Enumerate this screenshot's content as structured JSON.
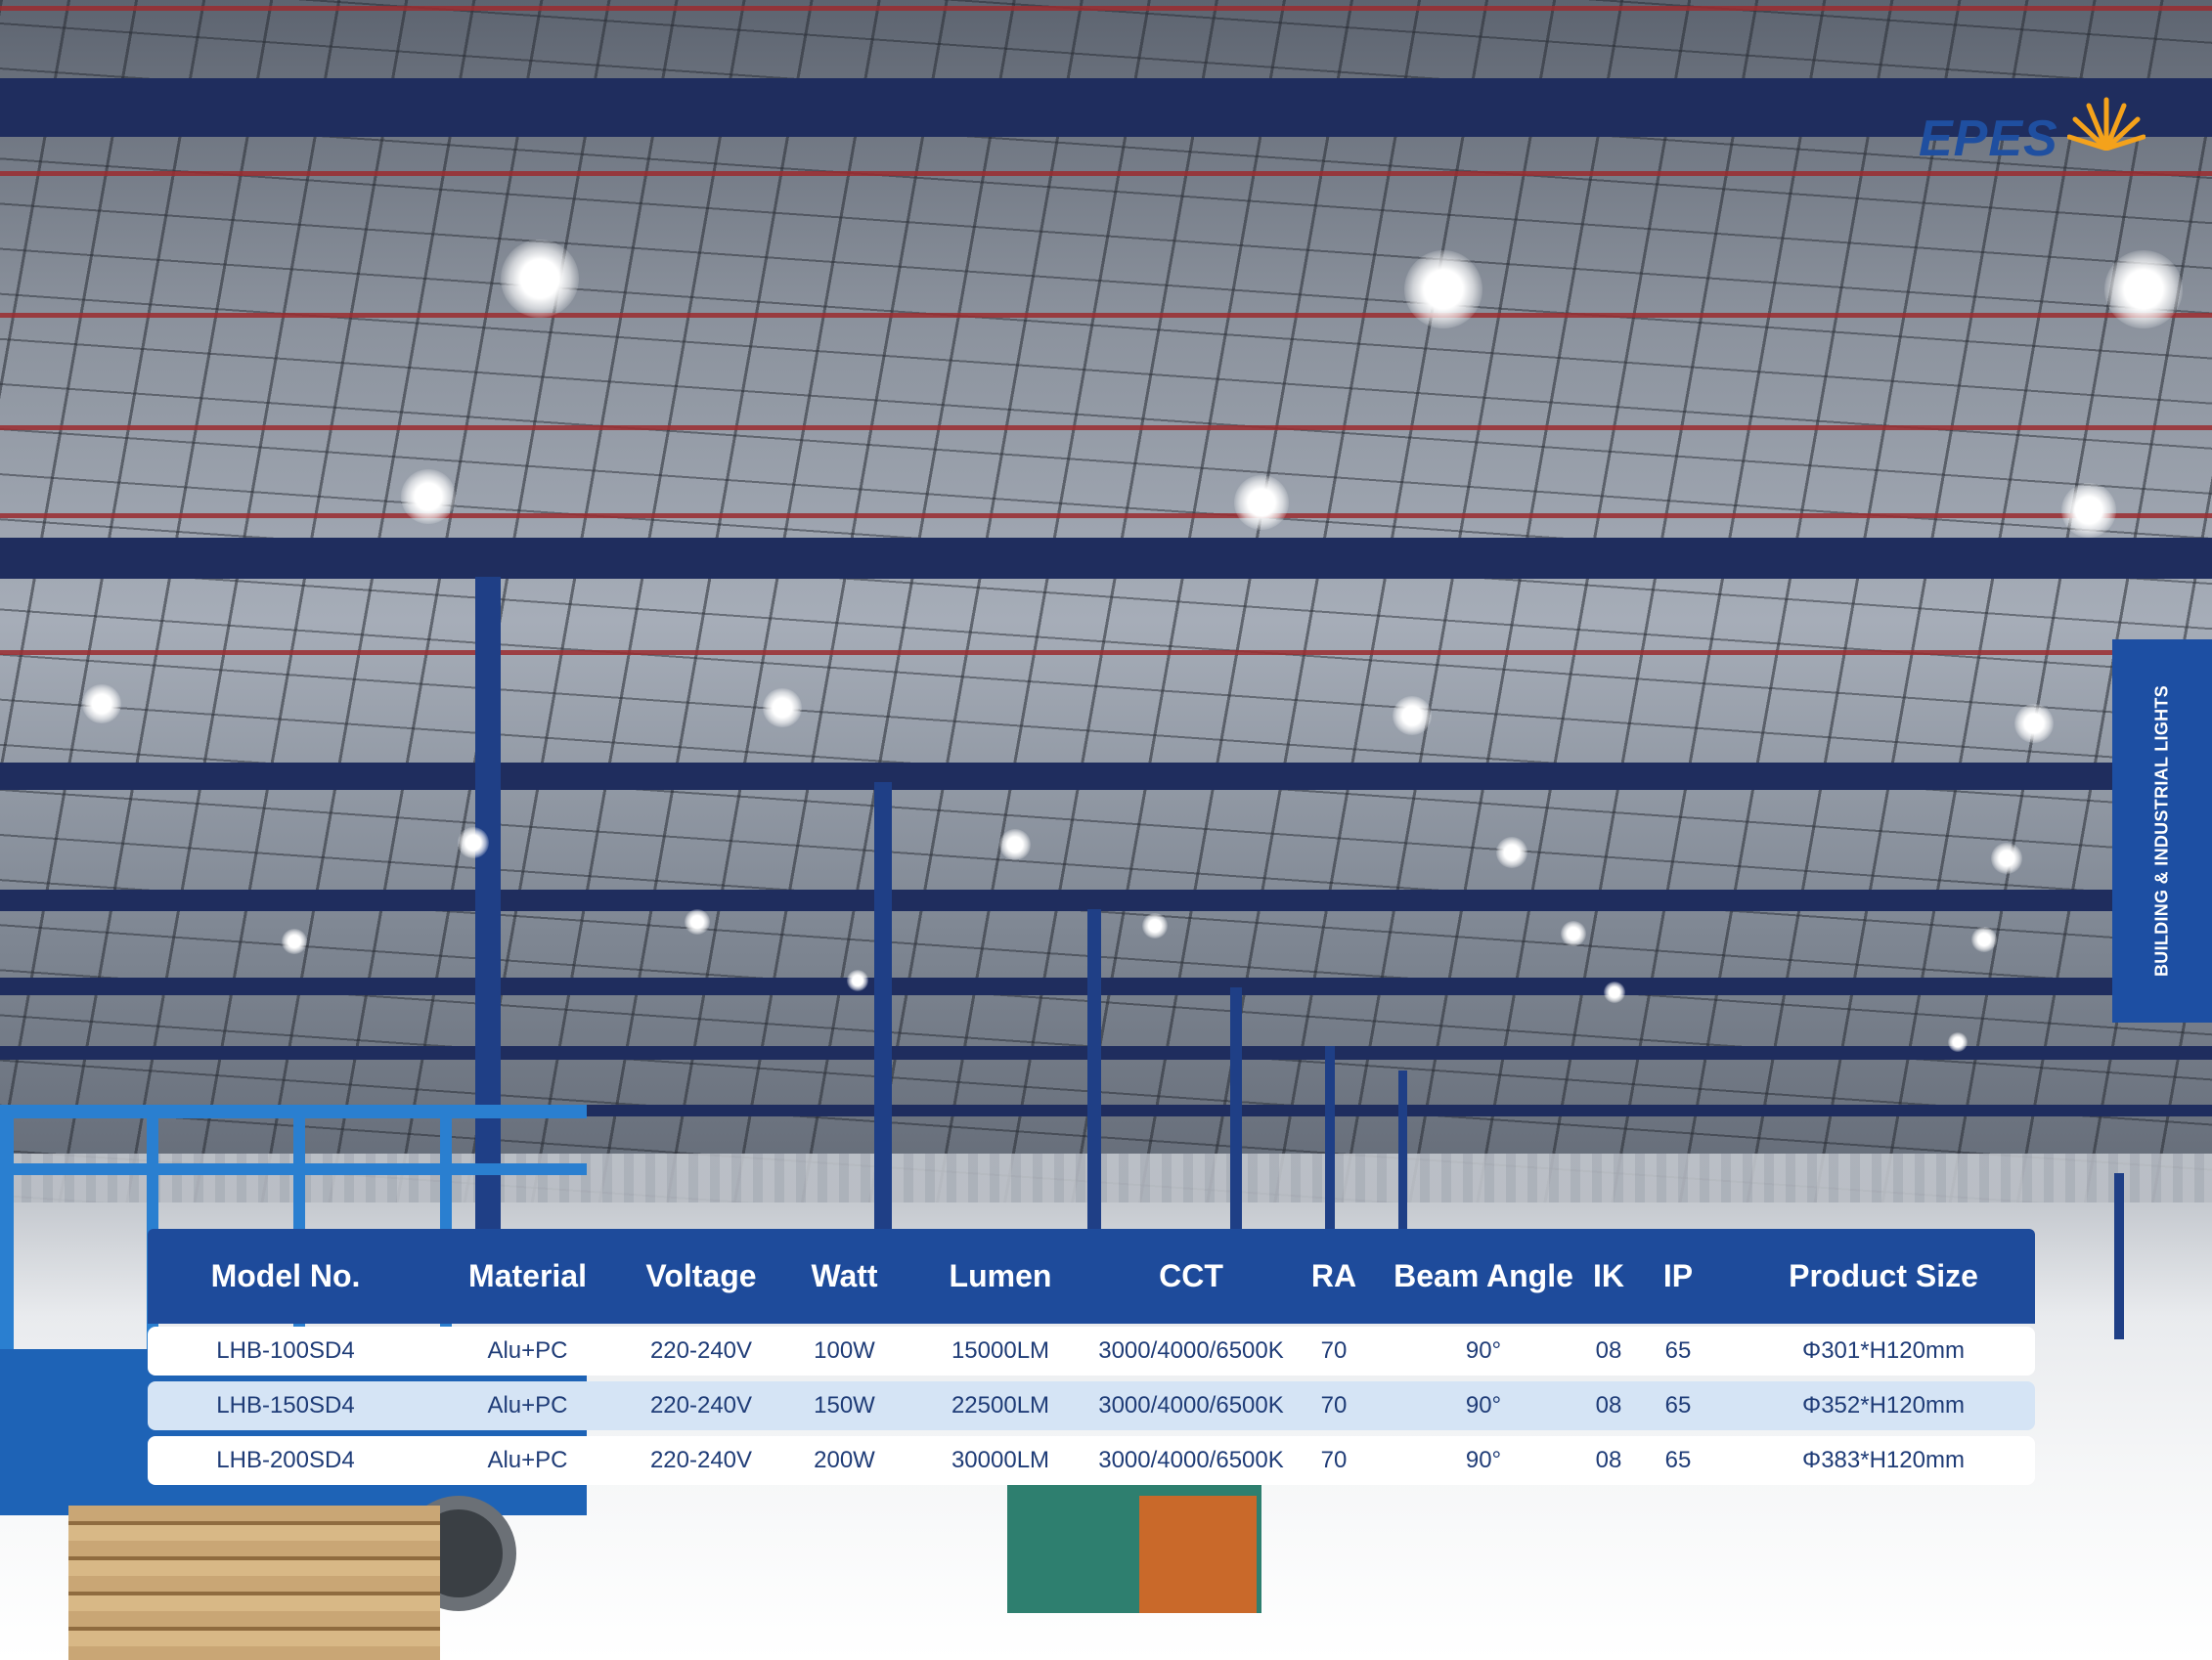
{
  "brand": {
    "logo_text": "EPES",
    "side_tab": "BUILDING & INDUSTRIAL LIGHTS",
    "colors": {
      "primary_blue": "#1e4b9b",
      "row_blue": "#d5e4f5",
      "text_blue": "#1f3c77",
      "sun_orange": "#f4a21b"
    }
  },
  "table": {
    "headers": [
      "Model No.",
      "Material",
      "Voltage",
      "Watt",
      "Lumen",
      "CCT",
      "RA",
      "Beam Angle",
      "IK",
      "IP",
      "Product Size"
    ],
    "rows": [
      [
        "LHB-100SD4",
        "Alu+PC",
        "220-240V",
        "100W",
        "15000LM",
        "3000/4000/6500K",
        "70",
        "90°",
        "08",
        "65",
        "Φ301*H120mm"
      ],
      [
        "LHB-150SD4",
        "Alu+PC",
        "220-240V",
        "150W",
        "22500LM",
        "3000/4000/6500K",
        "70",
        "90°",
        "08",
        "65",
        "Φ352*H120mm"
      ],
      [
        "LHB-200SD4",
        "Alu+PC",
        "220-240V",
        "200W",
        "30000LM",
        "3000/4000/6500K",
        "70",
        "90°",
        "08",
        "65",
        "Φ383*H120mm"
      ]
    ]
  }
}
